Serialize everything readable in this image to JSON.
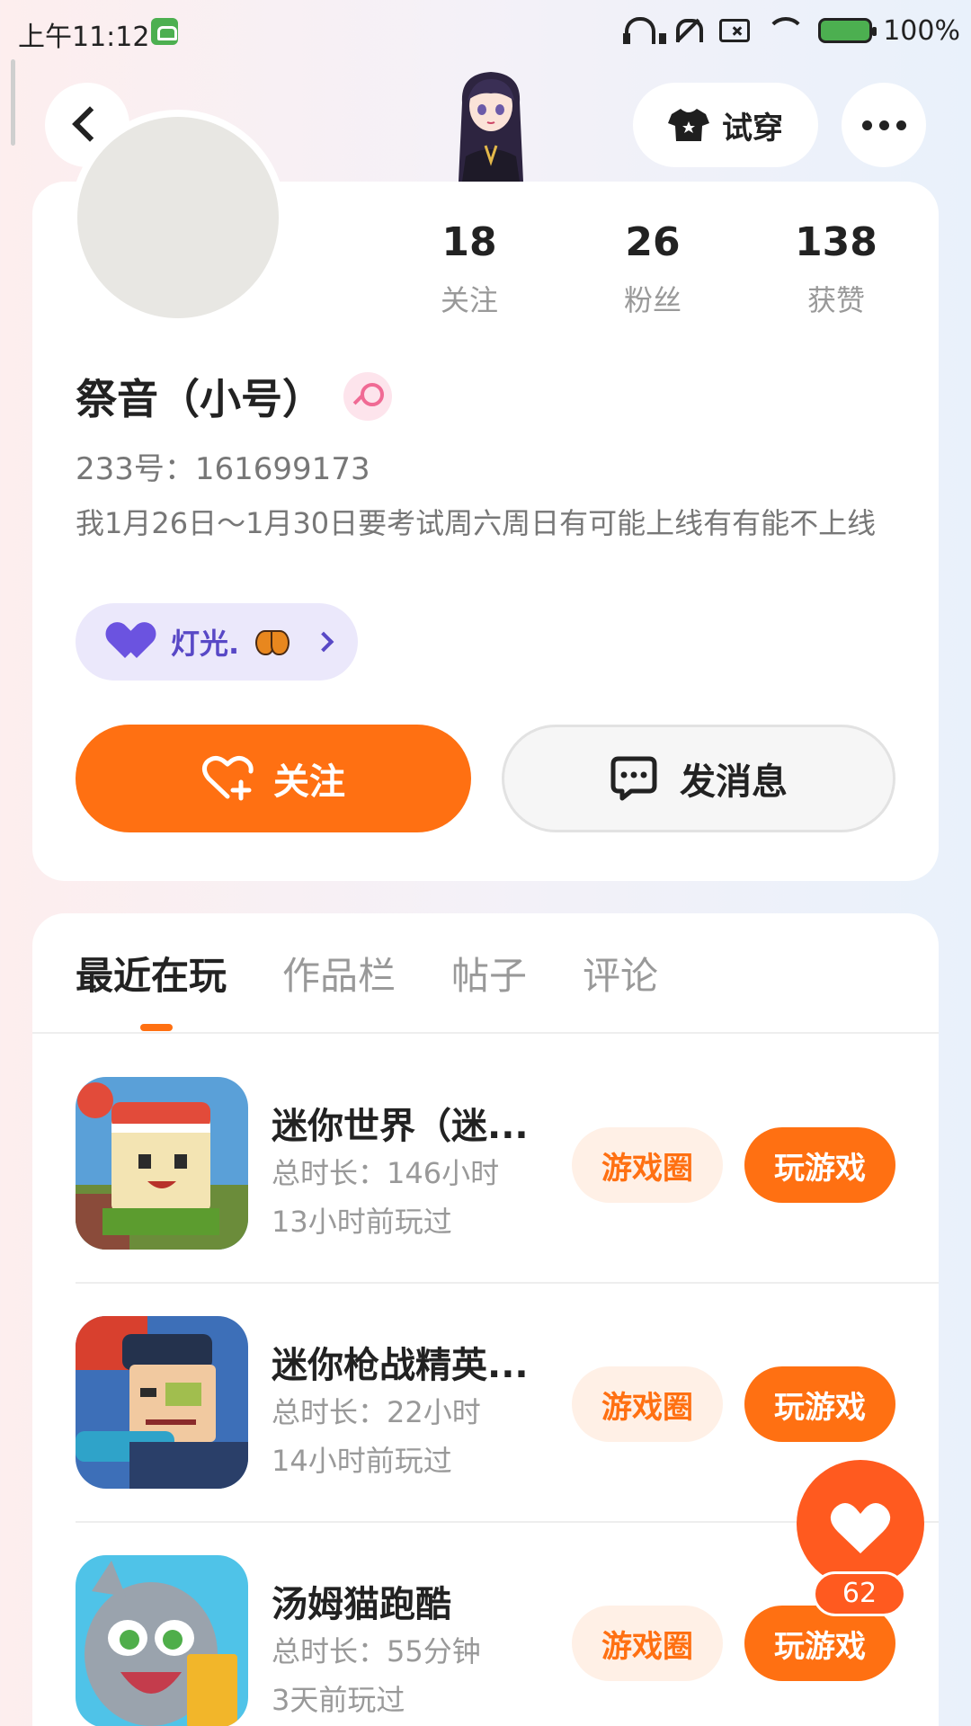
{
  "status_bar": {
    "time": "上午11:12",
    "battery": "100%"
  },
  "header": {
    "try_on_label": "试穿"
  },
  "profile": {
    "stats": [
      {
        "value": "18",
        "label": "关注"
      },
      {
        "value": "26",
        "label": "粉丝"
      },
      {
        "value": "138",
        "label": "获赞"
      }
    ],
    "name": "祭音（小号）",
    "uid": "233号：161699173",
    "bio": "我1月26日～1月30日要考试周六周日有可能上线有有能不上线",
    "light_tag": "灯光.",
    "follow_label": "关注",
    "message_label": "发消息"
  },
  "tabs": [
    {
      "label": "最近在玩",
      "active": true
    },
    {
      "label": "作品栏",
      "active": false
    },
    {
      "label": "帖子",
      "active": false
    },
    {
      "label": "评论",
      "active": false
    }
  ],
  "games": [
    {
      "title": "迷你世界（迷...",
      "total_time": "总时长：146小时",
      "last_played": "13小时前玩过",
      "circle_label": "游戏圈",
      "play_label": "玩游戏"
    },
    {
      "title": "迷你枪战精英...",
      "total_time": "总时长：22小时",
      "last_played": "14小时前玩过",
      "circle_label": "游戏圈",
      "play_label": "玩游戏"
    },
    {
      "title": "汤姆猫跑酷",
      "total_time": "总时长：55分钟",
      "last_played": "3天前玩过",
      "circle_label": "游戏圈",
      "play_label": "玩游戏"
    }
  ],
  "like_fab": {
    "count": "62"
  },
  "colors": {
    "accent": "#ff7012",
    "light_tag": "#5848c6"
  }
}
